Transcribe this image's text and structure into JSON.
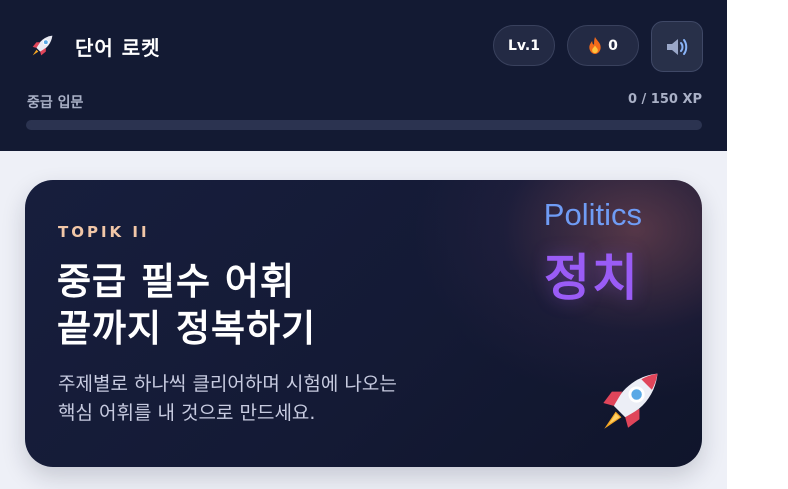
{
  "header": {
    "title": "단어 로켓",
    "logo_icon": "rocket-icon",
    "level": "Lv.1",
    "streak_icon": "flame-icon",
    "streak": "0",
    "sound_icon": "speaker-icon",
    "level_label": "중급 입문",
    "xp_text": "0 / 150 XP",
    "xp_progress": 0
  },
  "hero": {
    "eyebrow": "TOPIK II",
    "headline_line1": "중급 필수 어휘",
    "headline_line2": "끝까지 정복하기",
    "desc_line1": "주제별로 하나씩 클리어하며 시험에 나오는",
    "desc_line2": "핵심 어휘를 내 것으로 만드세요.",
    "word_en": "Politics",
    "word_ko": "정치",
    "decor_icon": "rocket-icon"
  },
  "colors": {
    "header_bg": "#131a33",
    "accent_blue": "#6f9cf5",
    "accent_purple": "#9a5cf6",
    "eyebrow": "#f2c7a8"
  }
}
